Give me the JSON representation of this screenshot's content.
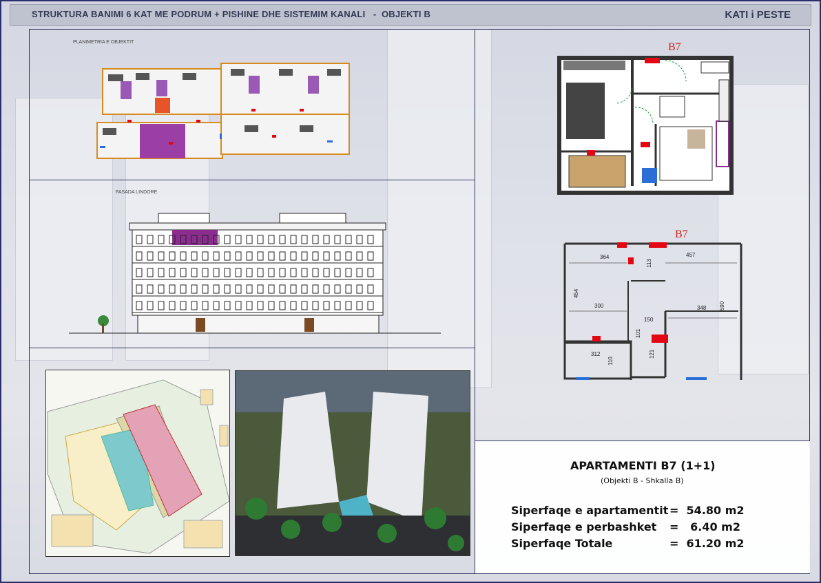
{
  "header": {
    "title": "STRUKTURA BANIMI 6 KAT ME PODRUM + PISHINE DHE SISTEMIM KANALI   -  OBJEKTI B",
    "floor": "KATI i PESTE"
  },
  "plan": {
    "label": "PLANIMETRIA E OBJEKTIT"
  },
  "facade": {
    "label": "FASADA LINDORE"
  },
  "apartment": {
    "label_top": "B7",
    "label_dims": "B7",
    "dims": [
      "364",
      "457",
      "300",
      "348",
      "150",
      "312",
      "454",
      "590",
      "110",
      "113",
      "121",
      "101"
    ]
  },
  "info": {
    "name": "APARTAMENTI B7 (1+1)",
    "sub": "(Objekti B - Shkalla B)",
    "rows": [
      {
        "label": "Siperfaqe e apartamentit",
        "value": "=  54.80 m2"
      },
      {
        "label": "Siperfaqe e perbashket",
        "value": "=   6.40 m2"
      },
      {
        "label": "Siperfaqe Totale",
        "value": "=  61.20 m2"
      }
    ]
  },
  "colors": {
    "accent": "#2f325f",
    "highlight": "#8b2d8f",
    "door": "#e30613"
  }
}
